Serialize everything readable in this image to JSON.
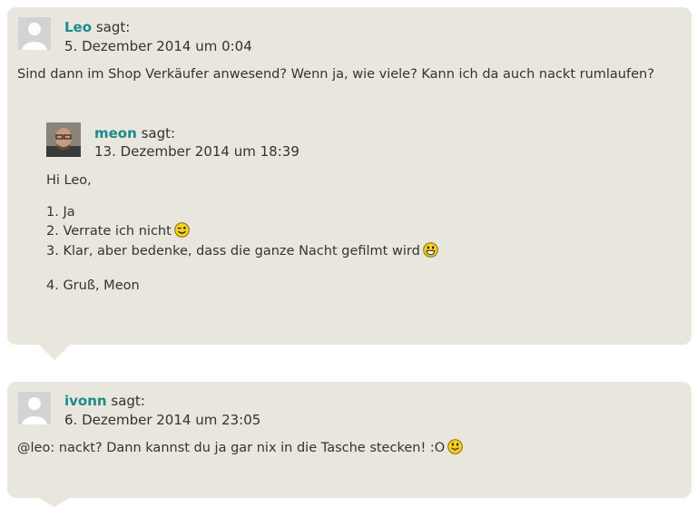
{
  "comments": [
    {
      "author": "Leo",
      "says": "sagt:",
      "date": "5. Dezember 2014 um 0:04",
      "text": "Sind dann im Shop Verkäufer anwesend? Wenn ja, wie viele? Kann ich da auch nackt rumlaufen?",
      "reply": {
        "author": "meon",
        "says": "sagt:",
        "date": "13. Dezember 2014 um 18:39",
        "greeting": "Hi Leo,",
        "list": [
          "1. Ja",
          "2. Verrate ich nicht",
          "3. Klar, aber bedenke, dass die ganze Nacht gefilmt wird",
          "4. Gruß, Meon"
        ]
      }
    },
    {
      "author": "ivonn",
      "says": "sagt:",
      "date": "6. Dezember 2014 um 23:05",
      "text": "@leo: nackt? Dann kannst du ja gar nix in die Tasche stecken! :O"
    }
  ],
  "icons": {
    "default_avatar": "default-avatar-icon",
    "wink": "wink-smiley-icon",
    "grin": "grin-smiley-icon",
    "tongue": "tongue-smiley-icon"
  },
  "colors": {
    "bubble": "#e8e6dd",
    "author": "#1a8a8a",
    "text": "#333333"
  }
}
